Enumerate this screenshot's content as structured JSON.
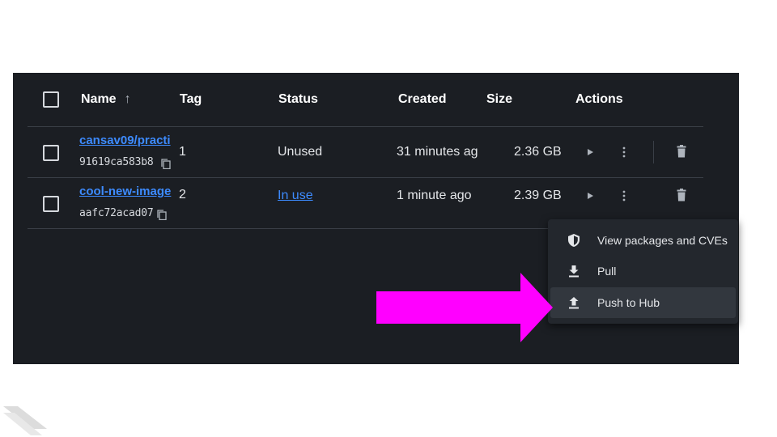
{
  "table": {
    "headers": {
      "name": "Name",
      "tag": "Tag",
      "status": "Status",
      "created": "Created",
      "size": "Size",
      "actions": "Actions"
    },
    "rows": [
      {
        "name": "cansav09/practi",
        "image_id": "91619ca583b8",
        "tag": "1",
        "status": "Unused",
        "created": "31 minutes ag",
        "size": "2.36 GB"
      },
      {
        "name": "cool-new-image",
        "image_id": "aafc72acad07",
        "tag": "2",
        "status": "In use",
        "created": "1 minute ago",
        "size": "2.39 GB"
      }
    ]
  },
  "context_menu": {
    "items": [
      {
        "label": "View packages and CVEs",
        "icon": "shield-icon"
      },
      {
        "label": "Pull",
        "icon": "download-icon"
      },
      {
        "label": "Push to Hub",
        "icon": "upload-icon"
      }
    ]
  },
  "colors": {
    "background": "#1b1e23",
    "link": "#3d8bff",
    "annotation_arrow": "#ff00ff"
  }
}
